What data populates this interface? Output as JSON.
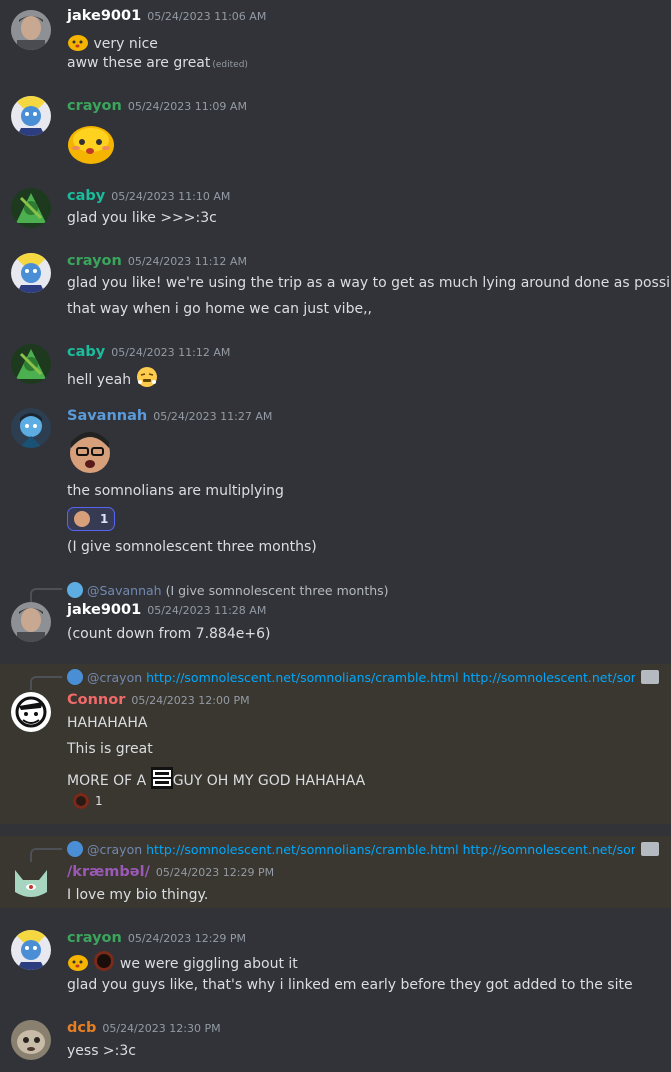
{
  "colors": {
    "bg": "#313338",
    "highlight": "#3a3630",
    "jake": "#ffffff",
    "crayon": "#3ba55c",
    "caby": "#1abc9c",
    "savannah": "#5a9bdb",
    "connor": "#f06a6a",
    "kraembal": "#9b59b6",
    "dcb": "#e67e22"
  },
  "messages": [
    {
      "author": "jake9001",
      "time": "05/24/2023 11:06 AM",
      "lines": [
        "very nice",
        "aww these are great"
      ],
      "edited": "(edited)"
    },
    {
      "author": "crayon",
      "time": "05/24/2023 11:09 AM"
    },
    {
      "author": "caby",
      "time": "05/24/2023 11:10 AM",
      "lines": [
        "glad you like >>>:3c"
      ]
    },
    {
      "author": "crayon",
      "time": "05/24/2023 11:12 AM",
      "lines": [
        "glad you like! we're using the trip as a way to get as much lying around done as possible",
        "that way when i go home we can just vibe,,"
      ]
    },
    {
      "author": "caby",
      "time": "05/24/2023 11:12 AM",
      "lines": [
        "hell yeah"
      ]
    },
    {
      "author": "Savannah",
      "time": "05/24/2023 11:27 AM",
      "lines": [
        "the somnolians are multiplying",
        "(I give somnolescent three months)"
      ],
      "reaction_count": "1"
    },
    {
      "author": "jake9001",
      "time": "05/24/2023 11:28 AM",
      "reply_mention": "@Savannah",
      "reply_text": "(I give somnolescent three months)",
      "lines": [
        "(count down from 7.884e+6)"
      ]
    },
    {
      "author": "Connor",
      "time": "05/24/2023 12:00 PM",
      "reply_mention": "@crayon",
      "reply_text": "http://somnolescent.net/somnolians/cramble.html http://somnolescent.net/somnolians/cramble.html",
      "lines": [
        "HAHAHAHA",
        "This is great",
        "MORE OF A",
        "GUY OH MY GOD HAHAHAA"
      ],
      "reaction_count": "1"
    },
    {
      "author": "/kræmbəl/",
      "time": "05/24/2023 12:29 PM",
      "reply_mention": "@crayon",
      "reply_text": "http://somnolescent.net/somnolians/cramble.html http://somnolescent.net/somnolians/cramble.html",
      "lines": [
        "I love my bio thingy."
      ]
    },
    {
      "author": "crayon",
      "time": "05/24/2023 12:29 PM",
      "lines": [
        "we were giggling about it",
        "glad you guys like, that's why i linked em early before they got added to the site"
      ]
    },
    {
      "author": "dcb",
      "time": "05/24/2023 12:30 PM",
      "lines": [
        "yess >:3c"
      ]
    }
  ]
}
